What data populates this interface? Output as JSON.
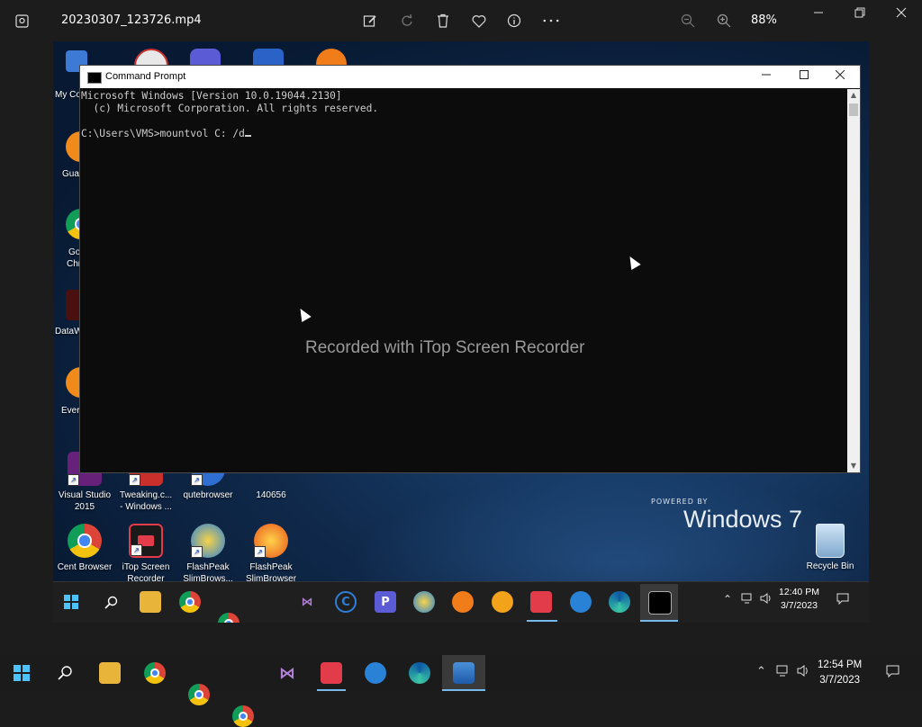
{
  "app": {
    "file_name": "20230307_123726.mp4",
    "zoom_level": "88%",
    "toolbar_icons": [
      "edit-icon",
      "rotate-icon",
      "delete-icon",
      "favorite-icon",
      "info-icon",
      "more-icon"
    ],
    "zoom_out_icon": "zoom-out-icon",
    "zoom_in_icon": "zoom-in-icon",
    "window_controls": [
      "minimize",
      "maximize",
      "close"
    ]
  },
  "cmd_window": {
    "title": "Command Prompt",
    "lines": [
      "Microsoft Windows [Version 10.0.19044.2130]",
      "(c) Microsoft Corporation. All rights reserved.",
      "",
      "C:\\Users\\VMS>mountvol C: /d"
    ]
  },
  "watermark": "Recorded with iTop Screen Recorder",
  "desktop": {
    "partial_labels": [
      "My Co",
      "Gua",
      "Go",
      "Chr",
      "DataW",
      "Ever"
    ],
    "icons": [
      {
        "label_1": "Visual Studio",
        "label_2": "2015",
        "icon": "visual-studio-icon"
      },
      {
        "label_1": "Tweaking.c...",
        "label_2": "- Windows ...",
        "icon": "tweaking-icon"
      },
      {
        "label_1": "qutebrowser",
        "label_2": "",
        "icon": "qutebrowser-icon"
      },
      {
        "label_1": "140656",
        "label_2": "",
        "icon": "folder-icon"
      },
      {
        "label_1": "Cent Browser",
        "label_2": "",
        "icon": "cent-browser-icon"
      },
      {
        "label_1": "iTop Screen",
        "label_2": "Recorder",
        "icon": "itop-recorder-icon"
      },
      {
        "label_1": "FlashPeak",
        "label_2": "SlimBrows...",
        "icon": "flashpeak-icon"
      },
      {
        "label_1": "FlashPeak",
        "label_2": "SlimBrowser",
        "icon": "flashpeak-icon"
      }
    ],
    "recycle_bin": "Recycle Bin",
    "branding_powered": "POWERED BY",
    "branding_os": "Windows 7"
  },
  "inner_taskbar": {
    "time": "12:40 PM",
    "date": "3/7/2023"
  },
  "taskbar": {
    "time": "12:54 PM",
    "date": "3/7/2023"
  },
  "colors": {
    "accent": "#76b9ed",
    "desktop_bg": "#102a4c",
    "console_bg": "#0c0c0c",
    "console_text": "#cccccc"
  }
}
